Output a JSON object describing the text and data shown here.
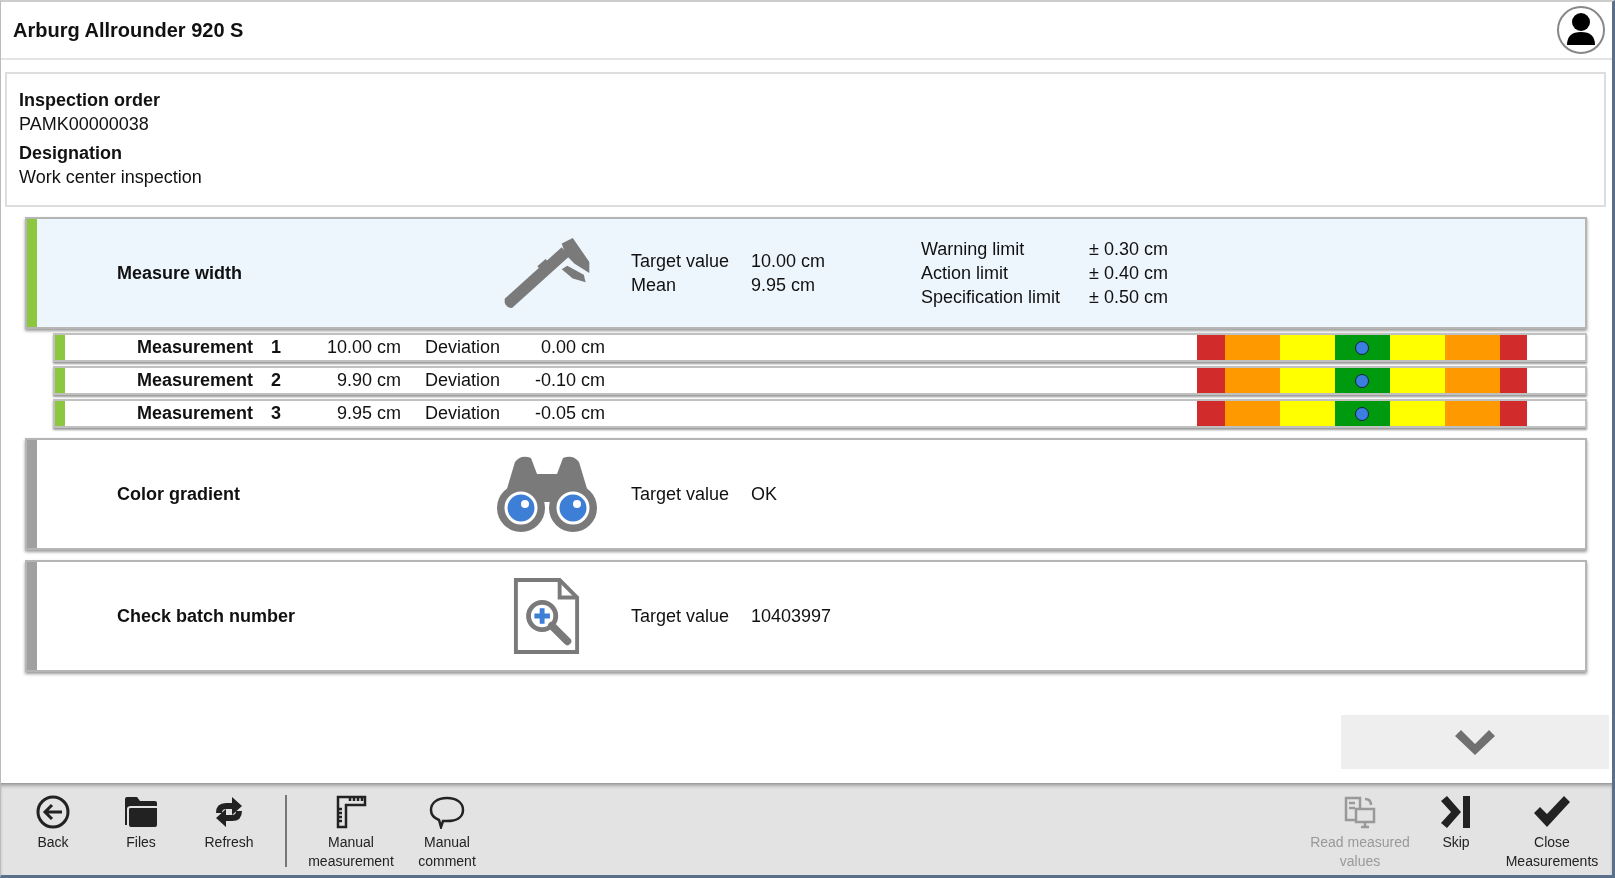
{
  "header": {
    "title": "Arburg Allrounder 920 S"
  },
  "info": [
    {
      "label": "Inspection order",
      "value": "PAMK00000038"
    },
    {
      "label": "Designation",
      "value": "Work center inspection"
    }
  ],
  "tasks": [
    {
      "name": "Measure width",
      "kind": "caliper",
      "selected": true,
      "color": "#8dc63f",
      "fields": [
        {
          "label": "Target value",
          "value": "10.00 cm"
        },
        {
          "label": "Mean",
          "value": "9.95 cm"
        }
      ],
      "limits": [
        {
          "label": "Warning limit",
          "value": "± 0.30 cm"
        },
        {
          "label": "Action limit",
          "value": "± 0.40 cm"
        },
        {
          "label": "Specification limit",
          "value": "± 0.50 cm"
        }
      ],
      "measurements": [
        {
          "label": "Measurement",
          "index": "1",
          "value": "10.00 cm",
          "deviation_label": "Deviation",
          "deviation": "0.00 cm",
          "color": "#8dc63f",
          "level": 0.5
        },
        {
          "label": "Measurement",
          "index": "2",
          "value": "9.90 cm",
          "deviation_label": "Deviation",
          "deviation": "-0.10 cm",
          "color": "#8dc63f",
          "level": 0.5
        },
        {
          "label": "Measurement",
          "index": "3",
          "value": "9.95 cm",
          "deviation_label": "Deviation",
          "deviation": "-0.05 cm",
          "color": "#8dc63f",
          "level": 0.5
        }
      ]
    },
    {
      "name": "Color gradient",
      "kind": "binoculars",
      "selected": false,
      "color": "#a0a0a0",
      "fields": [
        {
          "label": "Target value",
          "value": "OK"
        }
      ]
    },
    {
      "name": "Check batch number",
      "kind": "document-search",
      "selected": false,
      "color": "#a0a0a0",
      "fields": [
        {
          "label": "Target value",
          "value": "10403997"
        }
      ]
    }
  ],
  "toolbar": {
    "groups": [
      [
        {
          "label": "Back",
          "kind": "back",
          "disabled": false
        },
        {
          "label": "Files",
          "kind": "folder",
          "disabled": false
        },
        {
          "label": "Refresh",
          "kind": "refresh",
          "disabled": false
        }
      ],
      [
        {
          "label": "Manual measurement",
          "kind": "ruler",
          "disabled": false
        },
        {
          "label": "Manual comment",
          "kind": "comment",
          "disabled": false
        }
      ]
    ],
    "right": [
      {
        "label": "Read measured values",
        "kind": "read",
        "disabled": true
      },
      {
        "label": "Skip",
        "kind": "skip",
        "disabled": false
      },
      {
        "label": "Close Measurements",
        "kind": "check",
        "disabled": false
      }
    ]
  }
}
